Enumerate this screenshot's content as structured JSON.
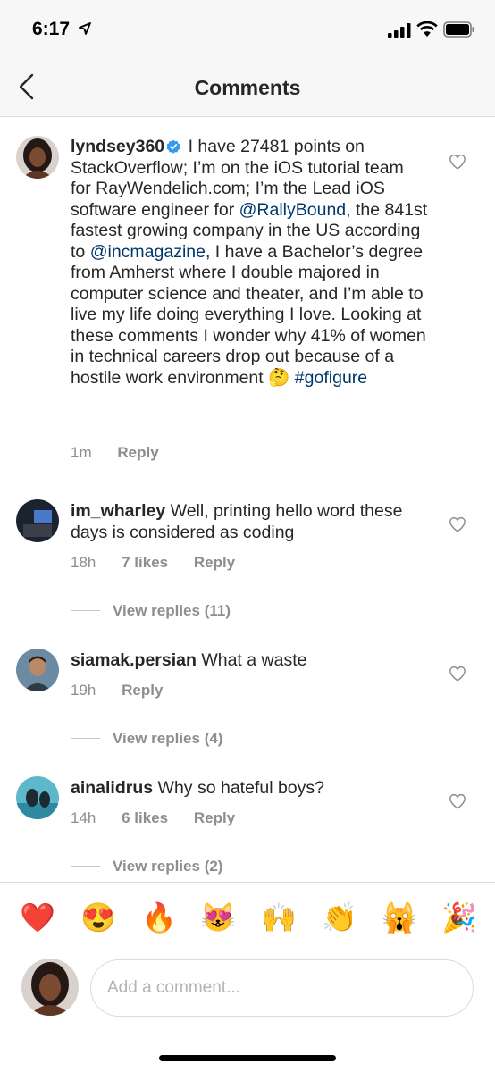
{
  "status_bar": {
    "time": "6:17"
  },
  "nav": {
    "title": "Comments"
  },
  "caption": {
    "username": "lyndsey360",
    "text_part1": " I have 27481 points on StackOverflow; I’m on the iOS tutorial team for RayWendelich.com; I’m the Lead iOS software engineer for ",
    "mention1": "@RallyBound",
    "text_part2": ", the 841st fastest growing company in the US according to ",
    "mention2": "@incmagazine",
    "text_part3": ", I have a Bachelor’s degree from Amherst where I double majored in computer science and theater, and I’m able to live my life doing everything I love. Looking at these comments I wonder why 41% of women in technical careers drop out because of a hostile work environment ",
    "emoji": "🤔",
    "hashtag": " #gofigure",
    "time": "1m",
    "reply_label": "Reply"
  },
  "comments": [
    {
      "username": "im_wharley",
      "text": " Well, printing hello word these days is considered as coding",
      "time": "18h",
      "likes": "7 likes",
      "reply_label": "Reply",
      "view_replies": "View replies (11)"
    },
    {
      "username": "siamak.persian",
      "text": " What a waste",
      "time": "19h",
      "reply_label": "Reply",
      "view_replies": "View replies (4)"
    },
    {
      "username": "ainalidrus",
      "text": " Why so hateful boys?",
      "time": "14h",
      "likes": "6 likes",
      "reply_label": "Reply",
      "view_replies": "View replies (2)"
    }
  ],
  "emoji_bar": [
    "❤️",
    "😍",
    "🔥",
    "😻",
    "🙌",
    "👏",
    "🙀",
    "🎉"
  ],
  "comment_input": {
    "placeholder": "Add a comment..."
  },
  "colors": {
    "link": "#00376b",
    "meta": "#8e8e8e",
    "verified": "#3897f0"
  }
}
